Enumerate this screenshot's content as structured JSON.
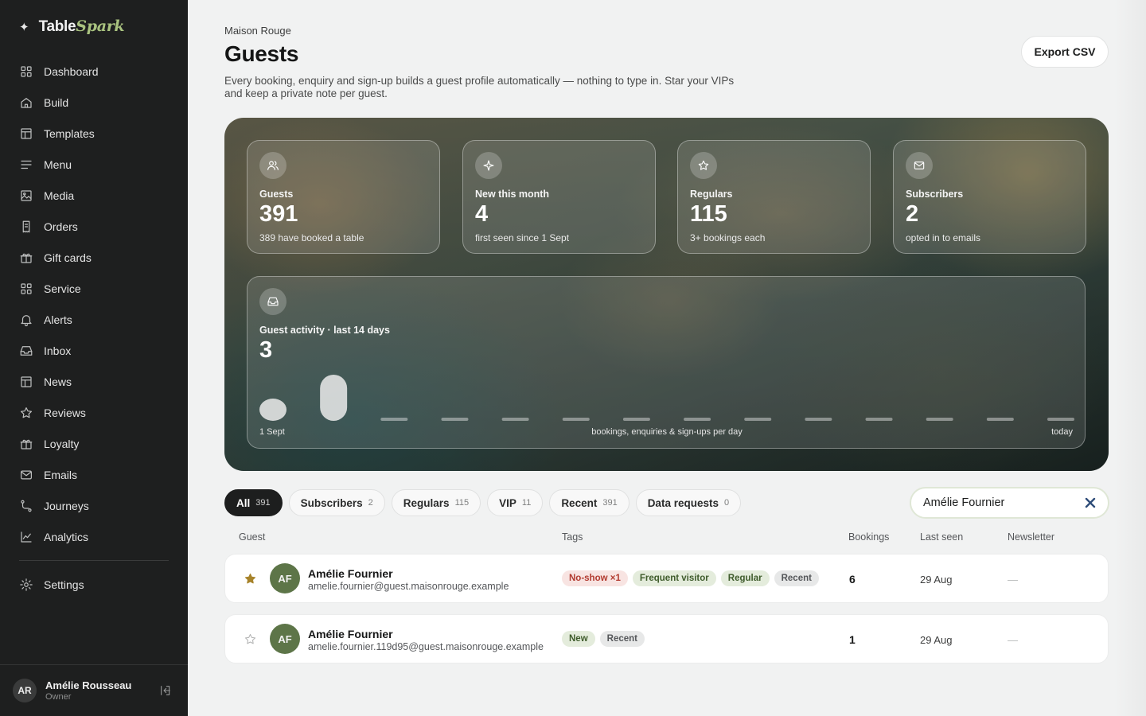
{
  "app": {
    "logo_plain": "Table",
    "logo_italic": "Spark"
  },
  "sidebar": {
    "items": [
      {
        "label": "Dashboard",
        "icon": "grid-icon"
      },
      {
        "label": "Build",
        "icon": "home-icon"
      },
      {
        "label": "Templates",
        "icon": "layout-icon"
      },
      {
        "label": "Menu",
        "icon": "lines-icon"
      },
      {
        "label": "Media",
        "icon": "image-icon"
      },
      {
        "label": "Orders",
        "icon": "receipt-icon"
      },
      {
        "label": "Gift cards",
        "icon": "gift-icon"
      },
      {
        "label": "Service",
        "icon": "grid-icon"
      },
      {
        "label": "Alerts",
        "icon": "bell-icon"
      },
      {
        "label": "Inbox",
        "icon": "inbox-icon"
      },
      {
        "label": "News",
        "icon": "layout-icon"
      },
      {
        "label": "Reviews",
        "icon": "star-icon"
      },
      {
        "label": "Loyalty",
        "icon": "gift-icon"
      },
      {
        "label": "Emails",
        "icon": "mail-icon"
      },
      {
        "label": "Journeys",
        "icon": "route-icon"
      },
      {
        "label": "Analytics",
        "icon": "chart-icon"
      }
    ],
    "settings_label": "Settings",
    "user": {
      "initials": "AR",
      "name": "Amélie Rousseau",
      "role": "Owner"
    }
  },
  "header": {
    "breadcrumb": "Maison Rouge",
    "title": "Guests",
    "description": "Every booking, enquiry and sign-up builds a guest profile automatically — nothing to type in. Star your VIPs and keep a private note per guest.",
    "export_label": "Export CSV"
  },
  "stats": [
    {
      "label": "Guests",
      "value": "391",
      "sub": "389 have booked a table",
      "icon": "users-icon"
    },
    {
      "label": "New this month",
      "value": "4",
      "sub": "first seen since 1 Sept",
      "icon": "sparkle-icon"
    },
    {
      "label": "Regulars",
      "value": "115",
      "sub": "3+ bookings each",
      "icon": "star-icon"
    },
    {
      "label": "Subscribers",
      "value": "2",
      "sub": "opted in to emails",
      "icon": "mail-icon"
    }
  ],
  "activity": {
    "label": "Guest activity · last 14 days",
    "value": "3",
    "axis_left": "1 Sept",
    "axis_center": "bookings, enquiries & sign-ups per day",
    "axis_right": "today"
  },
  "chart_data": {
    "type": "bar",
    "values": [
      1,
      2,
      0,
      0,
      0,
      0,
      0,
      0,
      0,
      0,
      0,
      0,
      0,
      0
    ],
    "ylim": [
      0,
      2
    ],
    "xlabel": "bookings, enquiries & sign-ups per day",
    "x_start_label": "1 Sept",
    "x_end_label": "today",
    "grid": false
  },
  "filters": [
    {
      "label": "All",
      "count": "391",
      "active": true
    },
    {
      "label": "Subscribers",
      "count": "2",
      "active": false
    },
    {
      "label": "Regulars",
      "count": "115",
      "active": false
    },
    {
      "label": "VIP",
      "count": "11",
      "active": false
    },
    {
      "label": "Recent",
      "count": "391",
      "active": false
    },
    {
      "label": "Data requests",
      "count": "0",
      "active": false
    }
  ],
  "search": {
    "value": "Amélie Fournier"
  },
  "table": {
    "headers": {
      "guest": "Guest",
      "tags": "Tags",
      "bookings": "Bookings",
      "last_seen": "Last seen",
      "newsletter": "Newsletter"
    },
    "rows": [
      {
        "starred": true,
        "initials": "AF",
        "name": "Amélie Fournier",
        "email": "amelie.fournier@guest.maisonrouge.example",
        "tags": [
          {
            "label": "No-show ×1",
            "kind": "noshow"
          },
          {
            "label": "Frequent visitor",
            "kind": "green"
          },
          {
            "label": "Regular",
            "kind": "green"
          },
          {
            "label": "Recent",
            "kind": "gray"
          }
        ],
        "bookings": "6",
        "last_seen": "29 Aug",
        "newsletter": "—"
      },
      {
        "starred": false,
        "initials": "AF",
        "name": "Amélie Fournier",
        "email": "amelie.fournier.119d95@guest.maisonrouge.example",
        "tags": [
          {
            "label": "New",
            "kind": "green"
          },
          {
            "label": "Recent",
            "kind": "gray"
          }
        ],
        "bookings": "1",
        "last_seen": "29 Aug",
        "newsletter": "—"
      }
    ]
  },
  "colors": {
    "sidebar_bg": "#1e1f1f",
    "accent_green": "#a9c27f",
    "star_gold": "#a7832a",
    "avatar_green": "#5d7548"
  }
}
